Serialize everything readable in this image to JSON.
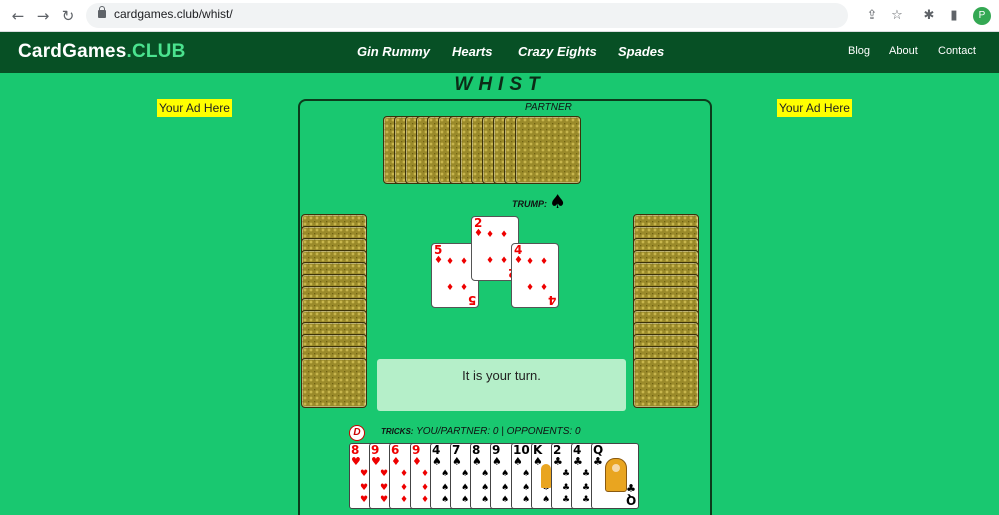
{
  "browser": {
    "url": "cardgames.club/whist/",
    "profile_initial": "P",
    "icons": [
      "back-arrow-icon",
      "forward-arrow-icon",
      "reload-icon",
      "lock-icon",
      "share-icon",
      "star-icon",
      "extensions-icon",
      "sidebar-icon"
    ]
  },
  "header": {
    "logo_main": "CardGames",
    "logo_suffix": ".CLUB",
    "games": [
      "Gin Rummy",
      "Hearts",
      "Crazy Eights",
      "Spades"
    ],
    "links": [
      "Blog",
      "About",
      "Contact"
    ]
  },
  "game": {
    "title": "WHIST",
    "ad_left": "Your Ad Here",
    "ad_right": "Your Ad Here",
    "partner_label": "PARTNER",
    "trump_label": "TRUMP:",
    "trump_suit": "♠",
    "message": "It is your turn.",
    "dealer_badge": "D",
    "tricks_label": "TRICKS:",
    "tricks_text": "YOU/PARTNER: 0 | OPPONENTS: 0",
    "partner_card_count": 13,
    "left_card_count": 13,
    "right_card_count": 13,
    "trick_cards": [
      {
        "rank": "5",
        "suit": "♦",
        "color": "red"
      },
      {
        "rank": "2",
        "suit": "♦",
        "color": "red"
      },
      {
        "rank": "4",
        "suit": "♦",
        "color": "red"
      }
    ],
    "hand": [
      {
        "rank": "8",
        "suit": "♥",
        "color": "red"
      },
      {
        "rank": "9",
        "suit": "♥",
        "color": "red"
      },
      {
        "rank": "6",
        "suit": "♦",
        "color": "red"
      },
      {
        "rank": "9",
        "suit": "♦",
        "color": "red"
      },
      {
        "rank": "4",
        "suit": "♠",
        "color": "black"
      },
      {
        "rank": "7",
        "suit": "♠",
        "color": "black"
      },
      {
        "rank": "8",
        "suit": "♠",
        "color": "black"
      },
      {
        "rank": "9",
        "suit": "♠",
        "color": "black"
      },
      {
        "rank": "10",
        "suit": "♠",
        "color": "black"
      },
      {
        "rank": "K",
        "suit": "♠",
        "color": "black"
      },
      {
        "rank": "2",
        "suit": "♣",
        "color": "black"
      },
      {
        "rank": "4",
        "suit": "♣",
        "color": "black"
      },
      {
        "rank": "Q",
        "suit": "♣",
        "color": "black"
      }
    ]
  },
  "colors": {
    "felt": "#19c870",
    "header_bg": "#075025",
    "logo_accent": "#4be38f",
    "ad_bg": "#ffff00",
    "message_bg": "#b5efc9"
  }
}
